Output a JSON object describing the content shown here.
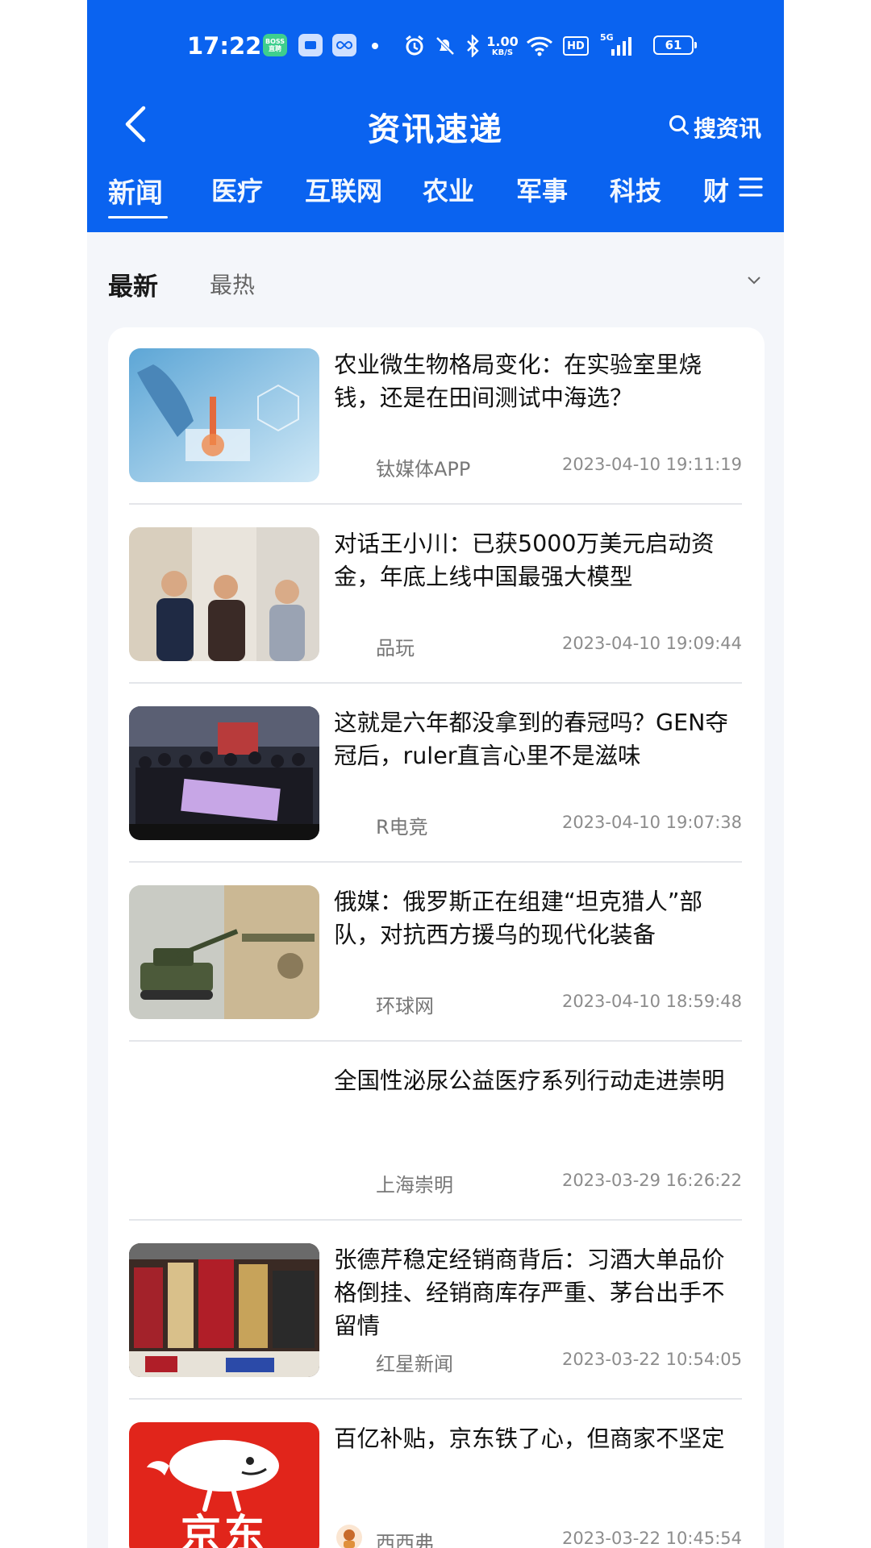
{
  "status_bar": {
    "time": "17:22",
    "app_badge_1": "BOSS 直聘",
    "net_speed_top": "1.00",
    "net_speed_bottom": "KB/S",
    "hd_label": "HD",
    "signal1_label": "5G",
    "signal2_label": "5G",
    "battery": "61"
  },
  "header": {
    "title": "资讯速递",
    "search_label": "搜资讯",
    "accent_color": "#0a63f0"
  },
  "tabs": [
    "新闻",
    "医疗",
    "互联网",
    "农业",
    "军事",
    "科技",
    "财"
  ],
  "sort": {
    "newest": "最新",
    "hottest": "最热"
  },
  "news": [
    {
      "title": "农业微生物格局变化：在实验室里烧钱，还是在田间测试中海选？",
      "source": "钛媒体APP",
      "date": "2023-04-10 19:11:19",
      "thumb": "lab-pipette-image"
    },
    {
      "title": "对话王小川：已获5000万美元启动资金，年底上线中国最强大模型",
      "source": "品玩",
      "date": "2023-04-10 19:09:44",
      "thumb": "three-executives-photo"
    },
    {
      "title": "这就是六年都没拿到的春冠吗？GEN夺冠后，ruler直言心里不是滋味",
      "source": "R电竞",
      "date": "2023-04-10 19:07:38",
      "thumb": "champions-team-photo"
    },
    {
      "title": "俄媒：俄罗斯正在组建“坦克猎人”部队，对抗西方援乌的现代化装备",
      "source": "环球网",
      "date": "2023-04-10 18:59:48",
      "thumb": "tank-and-soldier-photo"
    },
    {
      "title": "全国性泌尿公益医疗系列行动走进崇明",
      "source": "上海崇明",
      "date": "2023-03-29 16:26:22",
      "thumb": ""
    },
    {
      "title": "张德芹稳定经销商背后：习酒大单品价格倒挂、经销商库存严重、茅台出手不留情",
      "source": "红星新闻",
      "date": "2023-03-22 10:54:05",
      "thumb": "liquor-shelf-photo"
    },
    {
      "title": "百亿补贴，京东铁了心，但商家不坚定",
      "source": "西西弗",
      "date": "2023-03-22 10:45:54",
      "thumb": "jd-logo",
      "thumb_text": "京东"
    }
  ]
}
